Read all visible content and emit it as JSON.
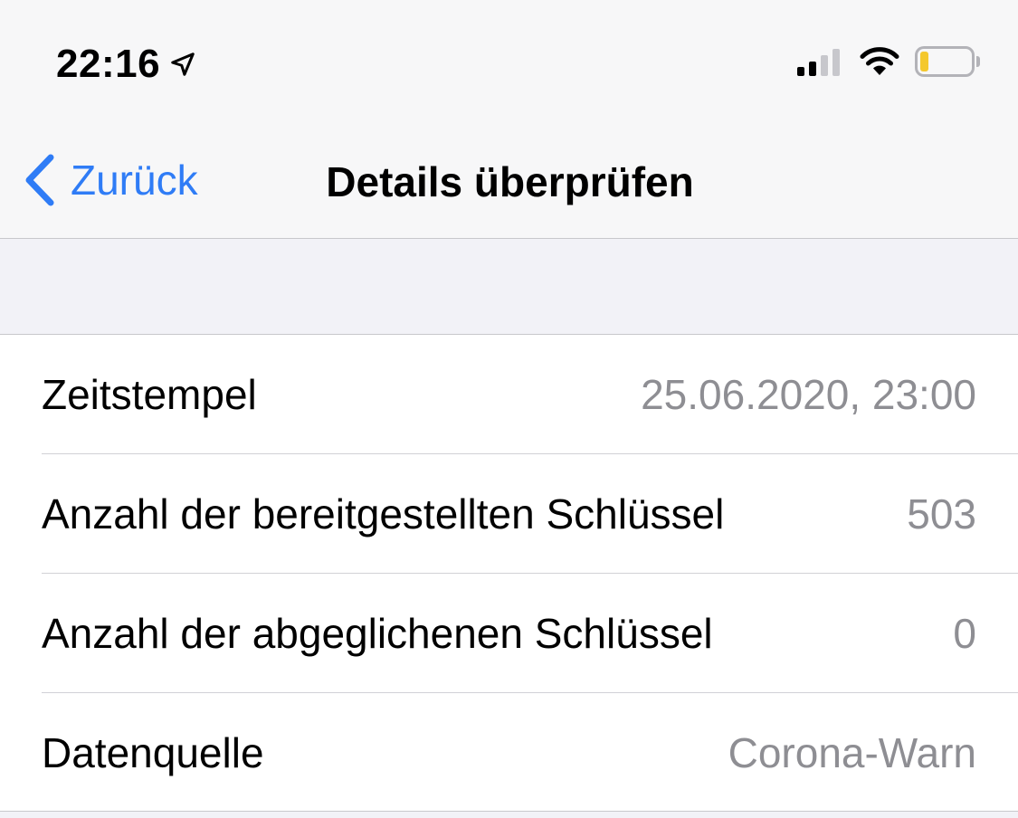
{
  "status_bar": {
    "time": "22:16",
    "location_icon": "location-arrow-icon",
    "signal_icon": "cellular-signal-icon",
    "wifi_icon": "wifi-icon",
    "battery_icon": "battery-icon",
    "battery_fill_color": "#f4c82e"
  },
  "nav": {
    "back_label": "Zurück",
    "title": "Details überprüfen",
    "accent_color": "#2f7cf6"
  },
  "details": [
    {
      "label": "Zeitstempel",
      "value": "25.06.2020, 23:00"
    },
    {
      "label": "Anzahl der bereitgestellten Schlüssel",
      "value": "503"
    },
    {
      "label": "Anzahl der abgeglichenen Schlüssel",
      "value": "0"
    },
    {
      "label": "Datenquelle",
      "value": "Corona-Warn"
    }
  ]
}
